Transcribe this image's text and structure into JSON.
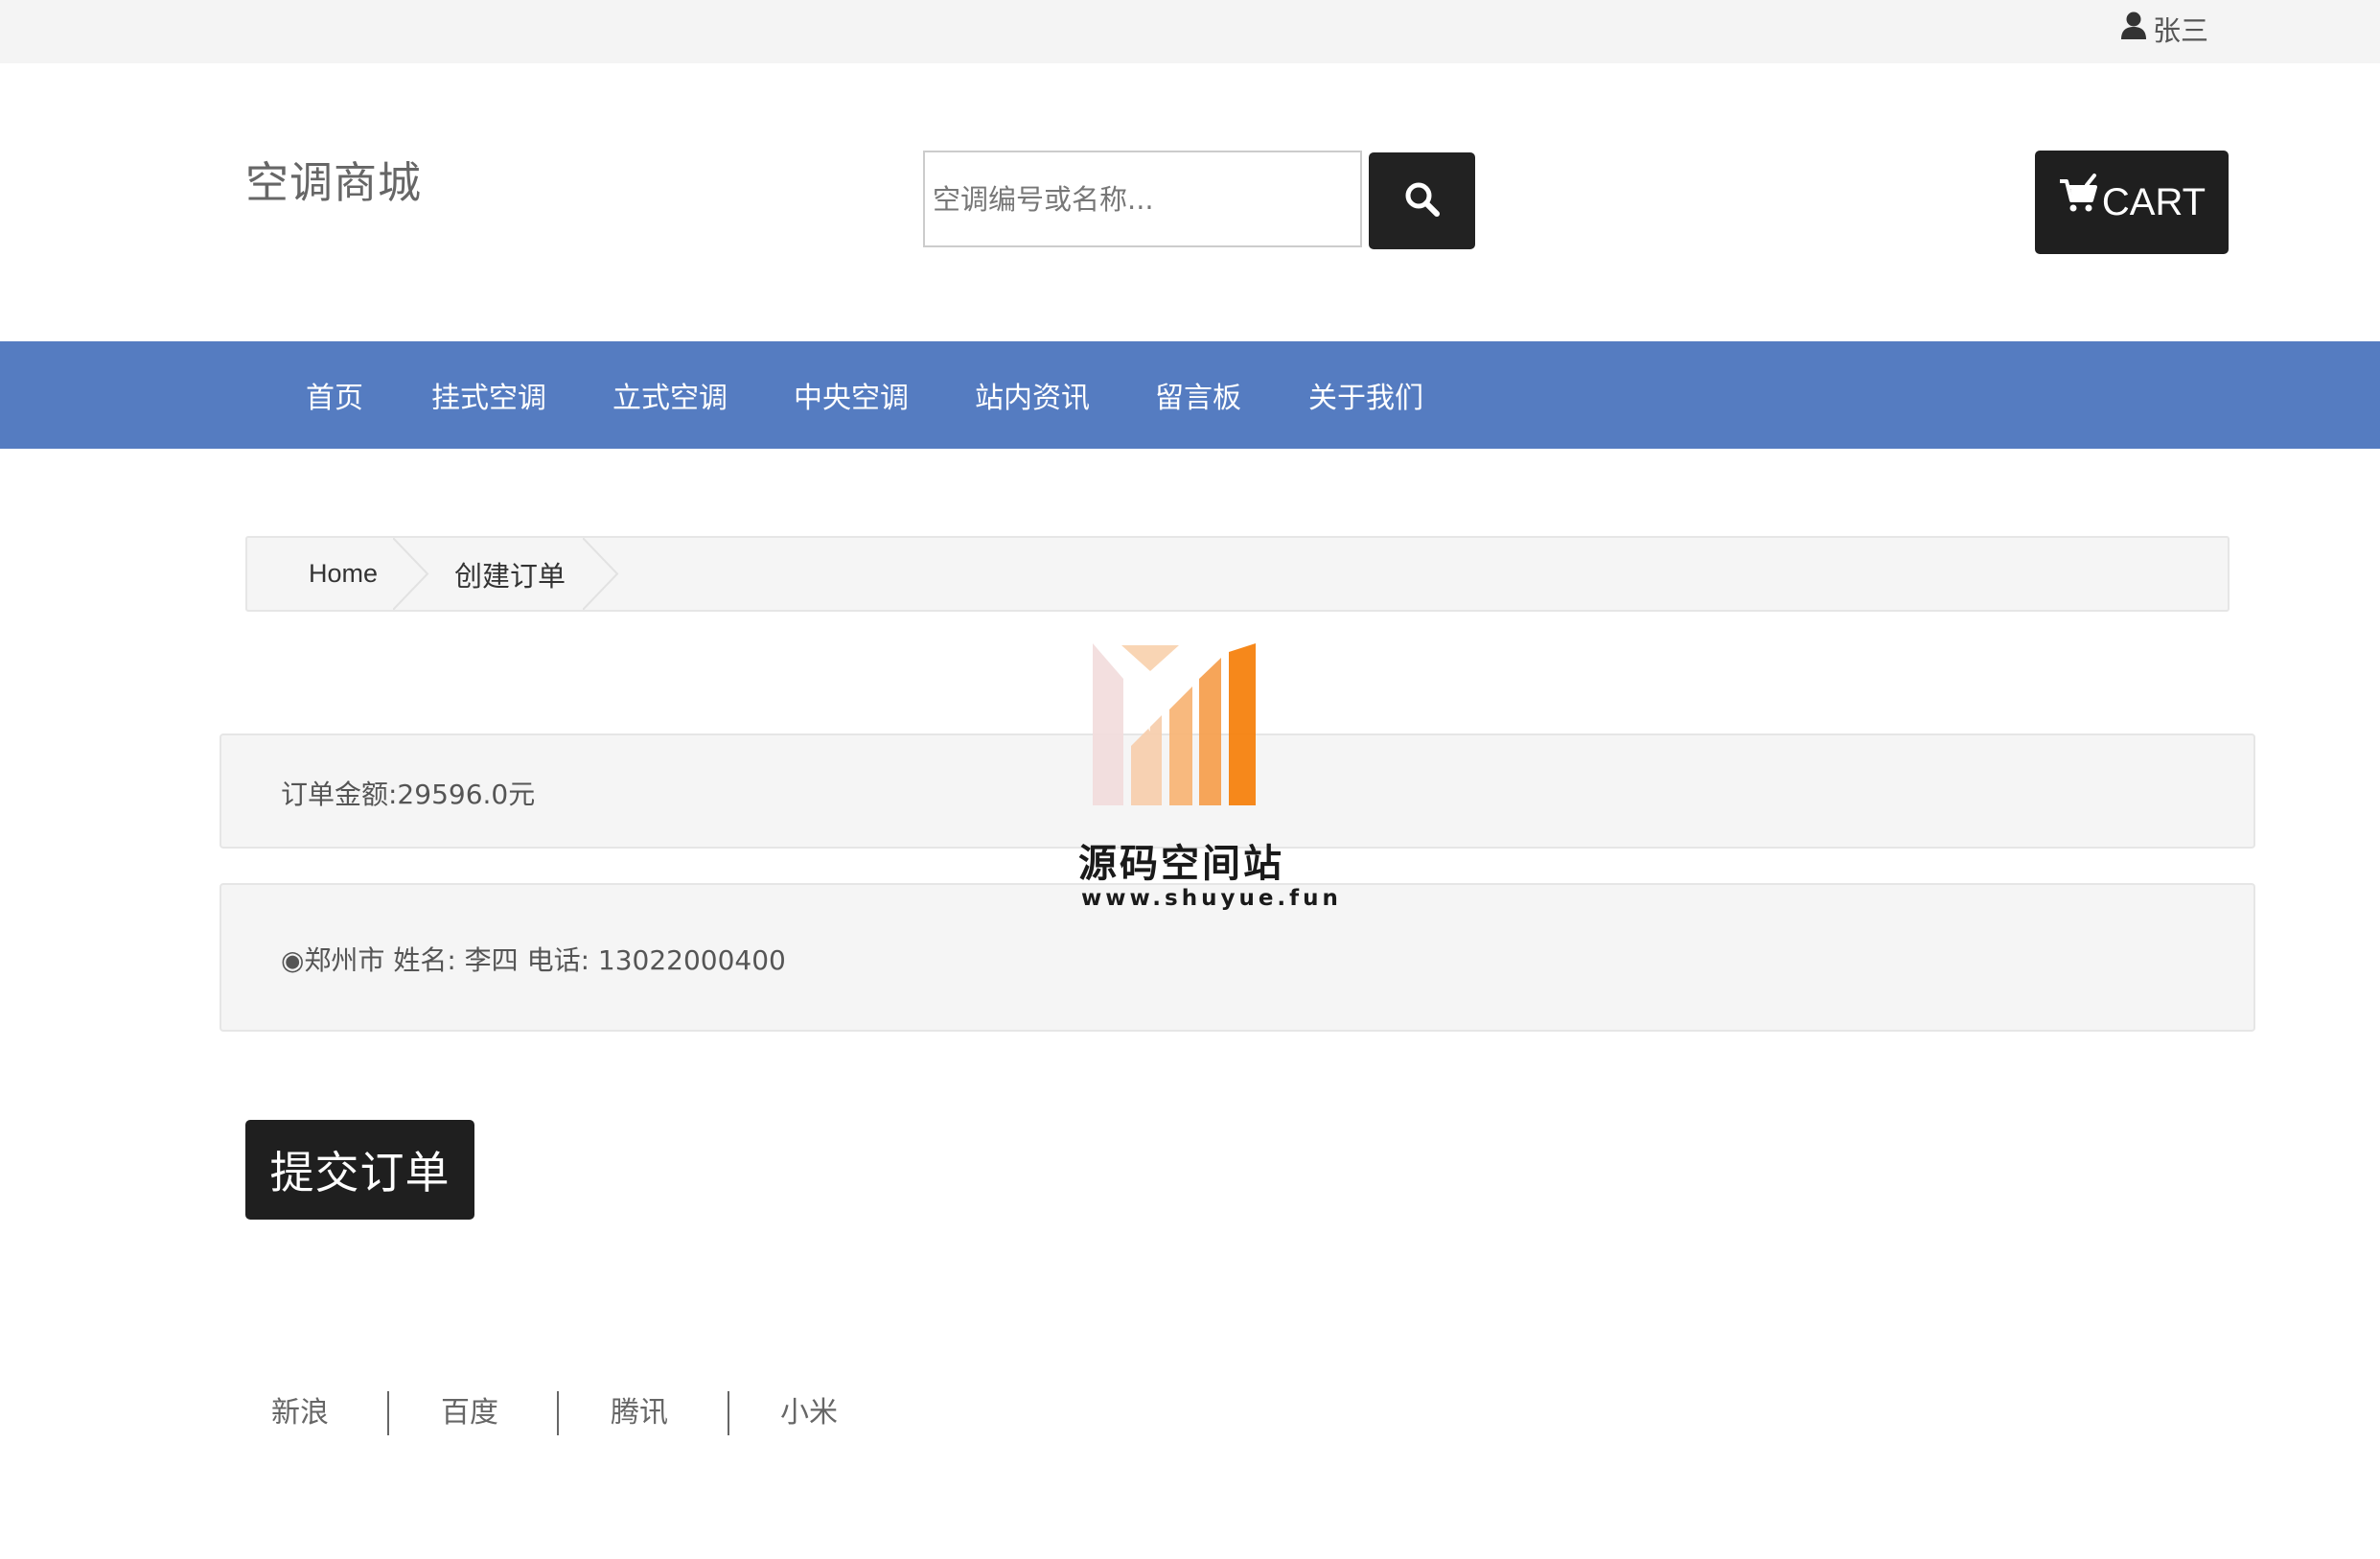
{
  "topbar": {
    "user_icon": "user-icon",
    "username": "张三"
  },
  "header": {
    "site_title": "空调商城",
    "search_placeholder": "空调编号或名称...",
    "search_icon": "search-icon",
    "cart_icon": "cart-icon",
    "cart_label": "CART"
  },
  "nav": {
    "items": [
      {
        "label": "首页"
      },
      {
        "label": "挂式空调"
      },
      {
        "label": "立式空调"
      },
      {
        "label": "中央空调"
      },
      {
        "label": "站内资讯"
      },
      {
        "label": "留言板"
      },
      {
        "label": "关于我们"
      }
    ]
  },
  "breadcrumb": {
    "home": "Home",
    "current": "创建订单"
  },
  "watermark": {
    "title": "源码空间站",
    "url": "www.shuyue.fun"
  },
  "order": {
    "amount_text": "订单金额:29596.0元",
    "address_text": "◉郑州市 姓名: 李四 电话: 13022000400",
    "submit_label": "提交订单"
  },
  "footer": {
    "links": [
      {
        "label": "新浪"
      },
      {
        "label": "百度"
      },
      {
        "label": "腾讯"
      },
      {
        "label": "小米"
      }
    ]
  },
  "colors": {
    "nav_bg": "#557cc1",
    "dark_button": "#1f1f1f",
    "topbar_bg": "#f4f4f4",
    "panel_bg": "#f5f5f5",
    "watermark_orange": "#f5820f"
  }
}
